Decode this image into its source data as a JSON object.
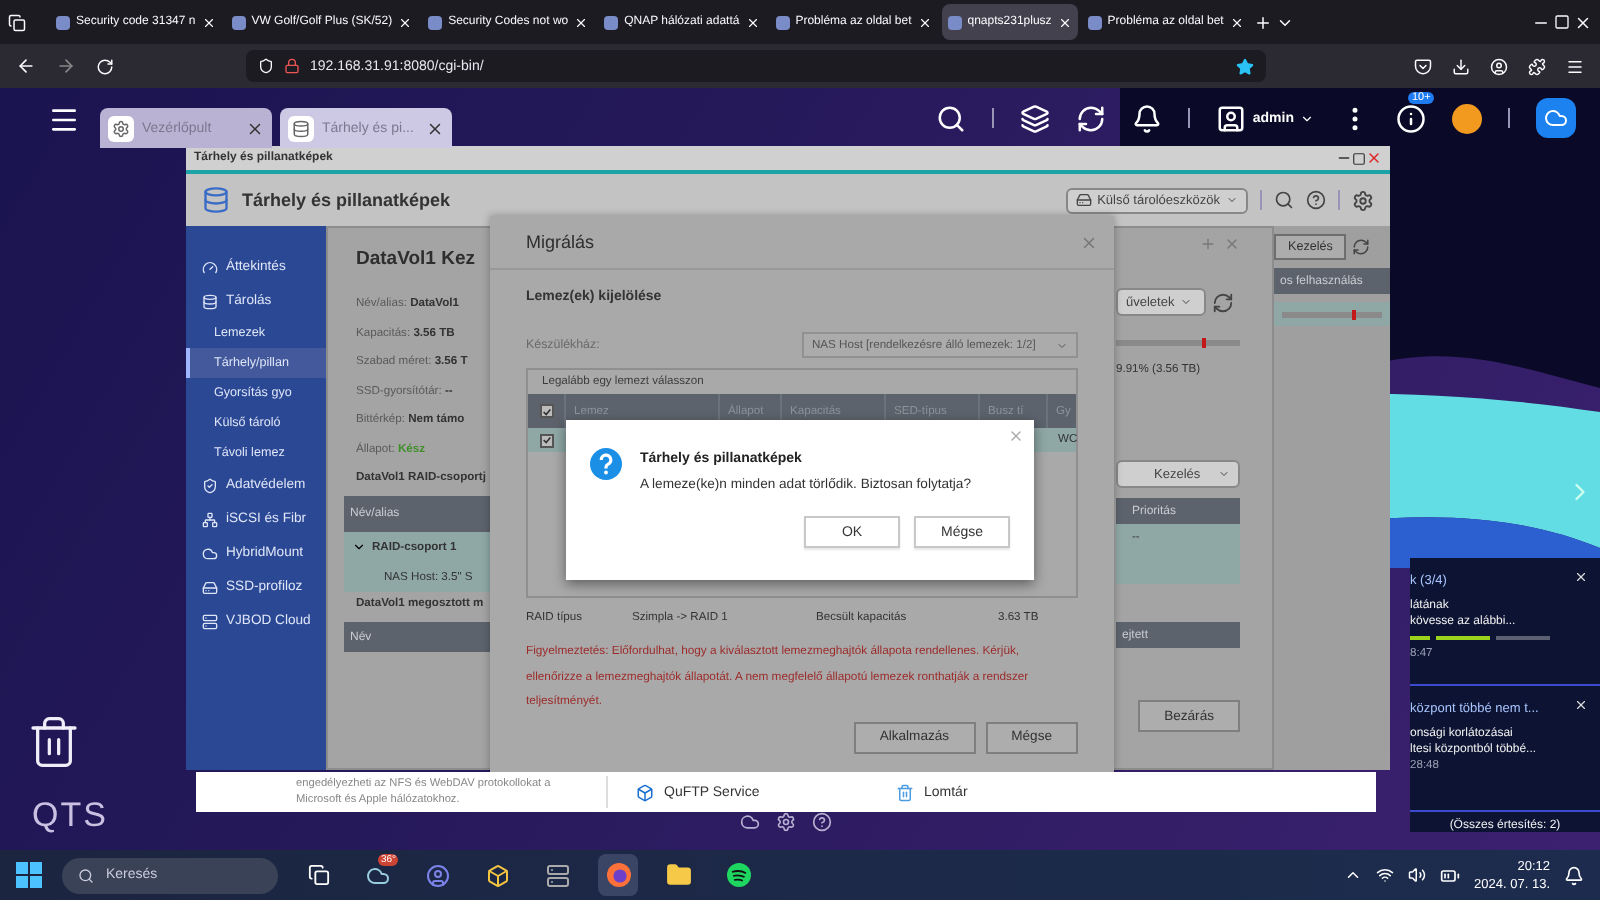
{
  "browser": {
    "tabs": [
      {
        "title": "Security code 31347 n",
        "selected": false
      },
      {
        "title": "VW Golf/Golf Plus (SK/52)",
        "selected": false
      },
      {
        "title": "Security Codes not wo",
        "selected": false
      },
      {
        "title": "QNAP hálózati adattá",
        "selected": false
      },
      {
        "title": "Probléma az oldal bet",
        "selected": false
      },
      {
        "title": "qnapts231plusz",
        "selected": true
      },
      {
        "title": "Probléma az oldal bet",
        "selected": false
      }
    ],
    "url": "192.168.31.91:8080/cgi-bin/"
  },
  "qts_bar": {
    "app_tabs": [
      {
        "label": "Vezérlőpult",
        "selected": false
      },
      {
        "label": "Tárhely és pi...",
        "selected": true
      }
    ],
    "user": "admin",
    "badge": "10+"
  },
  "storage_window": {
    "title": "Tárhely és pillanatképek",
    "header_title": "Tárhely és pillanatképek",
    "external_dropdown": "Külső tárolóeszközök",
    "sidebar": [
      {
        "label": "Áttekintés",
        "selected": false
      },
      {
        "label": "Tárolás",
        "selected": false,
        "children": [
          {
            "label": "Lemezek",
            "selected": false
          },
          {
            "label": "Tárhely/pillan",
            "selected": true
          },
          {
            "label": "Gyorsítás gyo",
            "selected": false
          },
          {
            "label": "Külső tároló",
            "selected": false
          },
          {
            "label": "Távoli lemez",
            "selected": false
          }
        ]
      },
      {
        "label": "Adatvédelem",
        "selected": false
      },
      {
        "label": "iSCSI és Fibr",
        "selected": false
      },
      {
        "label": "HybridMount",
        "selected": false
      },
      {
        "label": "SSD-profiloz",
        "selected": false
      },
      {
        "label": "VJBOD Cloud",
        "selected": false
      }
    ],
    "manage_button": "Kezelés",
    "column_header": "os felhasználás"
  },
  "volume_dialog": {
    "title": "DataVol1  Kez",
    "fields": [
      {
        "label": "Név/alias:",
        "value": "DataVol1"
      },
      {
        "label": "Kapacitás:",
        "value": "3.56 TB"
      },
      {
        "label": "Szabad méret:",
        "value": "3.56 T"
      },
      {
        "label": "SSD-gyorsítótár:",
        "value": "--"
      },
      {
        "label": "Bittérkép:",
        "value": "Nem támo"
      }
    ],
    "status": {
      "label": "Állapot:",
      "value": "Kész"
    },
    "raid_heading": "DataVol1 RAID-csoportj",
    "raid_column": "Név/alias",
    "raid_group": {
      "label": "RAID-csoport 1",
      "expanded": true
    },
    "raid_disk": "NAS Host: 3.5\" S",
    "shared_heading": "DataVol1 megosztott m",
    "shared_column": "Név",
    "actions": "űveletek",
    "usage": "9.91% (3.56 TB)",
    "manage_select": "Kezelés",
    "priority_column": "Prioritás",
    "priority_value": "--",
    "column_4": "ejtett",
    "close_button": "Bezárás"
  },
  "migration": {
    "title": "Migrálás",
    "section": "Lemez(ek) kijelölése",
    "enclosure_label": "Készülékház:",
    "enclosure_value": "NAS Host [rendelkezésre álló lemezek: 1/2]",
    "hint": "Legalább egy lemezt válasszon",
    "all_checked": true,
    "columns": [
      "Lemez",
      "Állapot",
      "Kapacitás",
      "SED-típus",
      "Busz tí",
      "Gy"
    ],
    "rows": [
      {
        "checked": true,
        "last_cell": "WC"
      }
    ],
    "raid_label": "RAID típus",
    "raid_value": "Szimpla -> RAID 1",
    "capacity_label": "Becsült kapacitás",
    "capacity_value": "3.63 TB",
    "warning": "Figyelmeztetés: Előfordulhat, hogy a kiválasztott lemezmeghajtók állapota rendellenes. Kérjük, ellenőrizze a lemezmeghajtók állapotát. A nem megfelelő állapotú lemezek ronthatják a rendszer teljesítményét.",
    "buttons": [
      "Alkalmazás",
      "Mégse"
    ]
  },
  "confirm": {
    "title": "Tárhely és pillanatképek",
    "message": "A lemeze(ke)n minden adat törlődik. Biztosan folytatja?",
    "buttons": [
      "OK",
      "Mégse"
    ]
  },
  "notifications": {
    "items": [
      {
        "title": "k (3/4)",
        "lines": [
          "látának",
          "kövesse az alábbi..."
        ],
        "steps": [
          {
            "done": true
          },
          {
            "done": true
          },
          {
            "done": false
          }
        ],
        "time": "8:47"
      },
      {
        "title": "központ többé nem t...",
        "lines": [
          "onsági korlátozásai",
          "ltesi központból többé..."
        ],
        "time": "28:48"
      }
    ],
    "footer": "(Összes értesítés: 2)"
  },
  "desktop": {
    "logo": "QTS"
  },
  "bottom_strip": {
    "description": "engedélyezheti az NFS és WebDAV protokollokat a Microsoft és Apple hálózatokhoz.",
    "apps": [
      "QuFTP Service",
      "Lomtár"
    ]
  },
  "taskbar": {
    "search": "Keresés",
    "weather": "36°",
    "time": "20:12",
    "date": "2024. 07. 13."
  }
}
